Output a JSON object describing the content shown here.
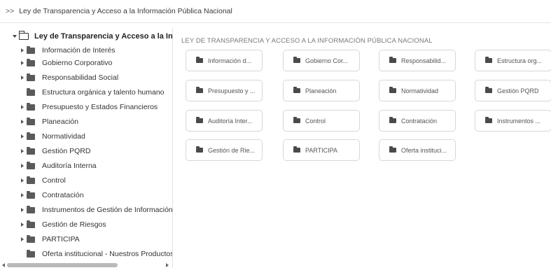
{
  "breadcrumb": {
    "separator": ">>",
    "text": "Ley de Transparencia y Acceso a la Información Pública Nacional"
  },
  "tree": {
    "root_label": "Ley de Transparencia y Acceso a la Información Pública Nacional",
    "root_icon": "folder-open-icon",
    "items": [
      {
        "label": "Información de Interés",
        "expandable": true
      },
      {
        "label": "Gobierno Corporativo",
        "expandable": true
      },
      {
        "label": "Responsabilidad Social",
        "expandable": true
      },
      {
        "label": "Estructura orgánica y talento humano",
        "expandable": false
      },
      {
        "label": "Presupuesto y Estados Financieros",
        "expandable": true
      },
      {
        "label": "Planeación",
        "expandable": true
      },
      {
        "label": "Normatividad",
        "expandable": true
      },
      {
        "label": "Gestión PQRD",
        "expandable": true
      },
      {
        "label": "Auditoría Interna",
        "expandable": true
      },
      {
        "label": "Control",
        "expandable": true
      },
      {
        "label": "Contratación",
        "expandable": true
      },
      {
        "label": "Instrumentos de Gestión de Información",
        "expandable": true
      },
      {
        "label": "Gestión de Riesgos",
        "expandable": true
      },
      {
        "label": "PARTICIPA",
        "expandable": true
      },
      {
        "label": "Oferta institucional - Nuestros Productos",
        "expandable": false
      }
    ]
  },
  "main": {
    "section_title": "LEY DE TRANSPARENCIA Y ACCESO A LA INFORMACIÓN PÚBLICA NACIONAL",
    "cards": [
      {
        "label": "Información d..."
      },
      {
        "label": "Gobierno Cor..."
      },
      {
        "label": "Responsabilid..."
      },
      {
        "label": "Estructura org..."
      },
      {
        "label": "Presupuesto y ..."
      },
      {
        "label": "Planeación"
      },
      {
        "label": "Normatividad"
      },
      {
        "label": "Gestión PQRD"
      },
      {
        "label": "Auditoría Inter..."
      },
      {
        "label": "Control"
      },
      {
        "label": "Contratación"
      },
      {
        "label": "Instrumentos ..."
      },
      {
        "label": "Gestión de Rie..."
      },
      {
        "label": "PARTICIPA"
      },
      {
        "label": "Oferta instituci..."
      }
    ]
  },
  "colors": {
    "folder": "#5a5a5a",
    "card_border": "#d7d7d7",
    "section_title": "#7a7a7a"
  }
}
